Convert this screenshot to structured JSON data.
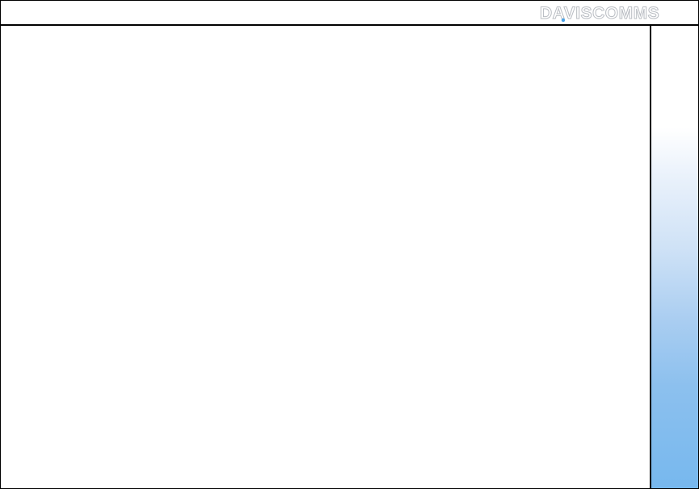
{
  "header": {
    "logo_text": "DAVISCOMMS"
  },
  "colors": {
    "border": "#000000",
    "logo_stroke": "#b8bcc2",
    "logo_accent": "#4aa3e8",
    "panel_gradient_top": "#ffffff",
    "panel_gradient_bottom": "#77b8ee"
  }
}
